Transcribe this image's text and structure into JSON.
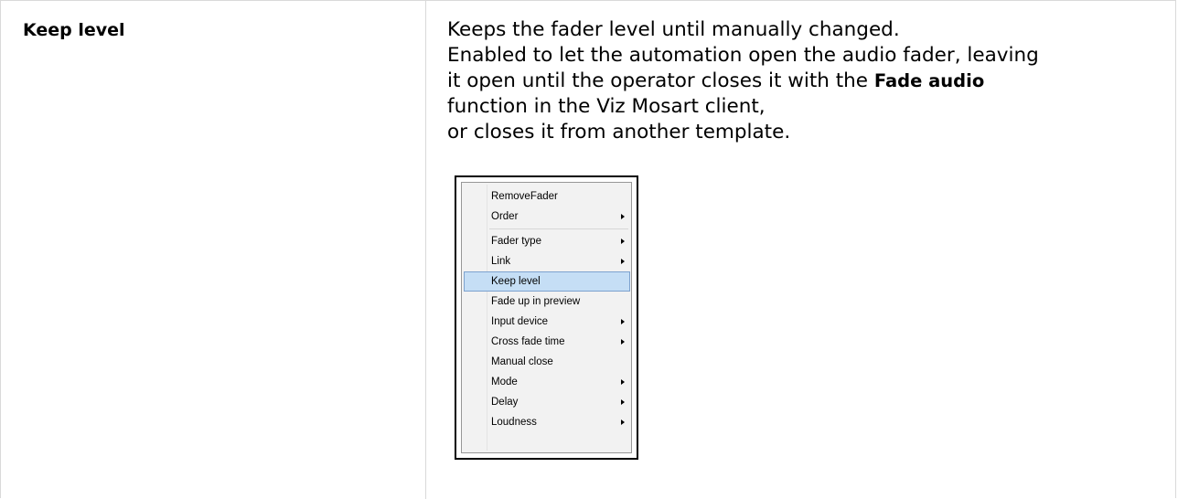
{
  "row": {
    "term": "Keep level",
    "description": {
      "line1": "Keeps the fader level until manually changed.",
      "line2": "Enabled to let the automation open the audio fader, leaving",
      "line3_before": "it open until the operator closes it with the ",
      "line3_bold": "Fade audio",
      "line4": "function in the Viz Mosart client,",
      "line5": "or closes it from another template."
    }
  },
  "context_menu": {
    "items": [
      {
        "label": "RemoveFader",
        "submenu": false
      },
      {
        "label": "Order",
        "submenu": true
      },
      {
        "label": "Fader type",
        "submenu": true
      },
      {
        "label": "Link",
        "submenu": true
      },
      {
        "label": "Keep level",
        "submenu": false,
        "highlighted": true
      },
      {
        "label": "Fade up in preview",
        "submenu": false
      },
      {
        "label": "Input device",
        "submenu": true
      },
      {
        "label": "Cross fade time",
        "submenu": true
      },
      {
        "label": "Manual close",
        "submenu": false
      },
      {
        "label": "Mode",
        "submenu": true
      },
      {
        "label": "Delay",
        "submenu": true
      },
      {
        "label": "Loudness",
        "submenu": true
      }
    ],
    "highlight_color": "#c5def5",
    "highlight_border_color": "#7da2ce"
  }
}
